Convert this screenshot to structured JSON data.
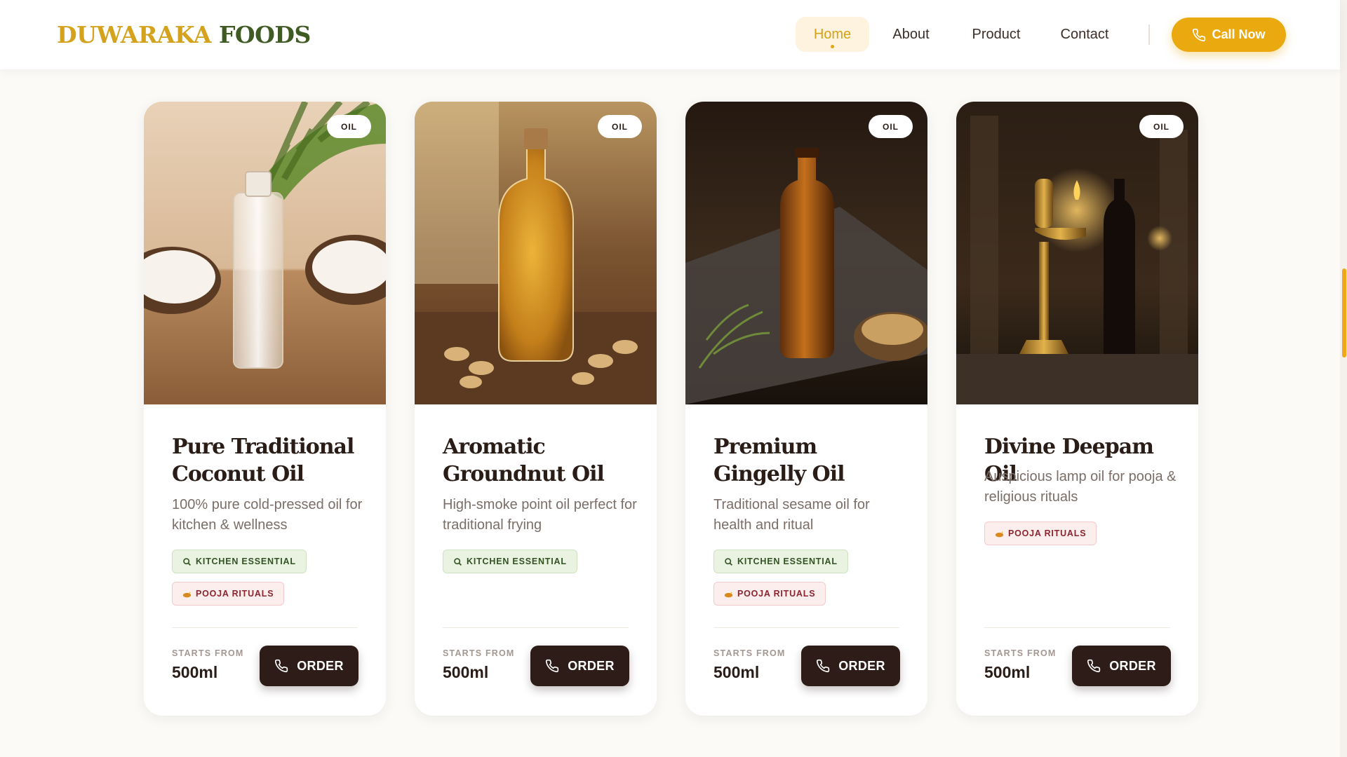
{
  "brand": {
    "word1": "DUWARAKA",
    "word2": "FOODS"
  },
  "nav": {
    "items": [
      {
        "label": "Home",
        "active": true
      },
      {
        "label": "About",
        "active": false
      },
      {
        "label": "Product",
        "active": false
      },
      {
        "label": "Contact",
        "active": false
      }
    ],
    "cta_label": "Call Now"
  },
  "colors": {
    "accent": "#eaa90f",
    "brand_gold": "#d4a21c",
    "brand_green": "#3f5a22",
    "order_button": "#2d1c17"
  },
  "products": [
    {
      "badge": "OIL",
      "title": "Pure Traditional Coconut Oil",
      "description": "100% pure cold-pressed oil for kitchen & wellness",
      "tags": [
        {
          "label": "KITCHEN ESSENTIAL",
          "kind": "kitchen",
          "icon": "search-icon"
        },
        {
          "label": "POOJA RITUALS",
          "kind": "pooja",
          "icon": "lamp-icon"
        }
      ],
      "starts_label": "STARTS FROM",
      "size": "500ml",
      "order_label": "ORDER"
    },
    {
      "badge": "OIL",
      "title": "Aromatic Groundnut Oil",
      "description": "High-smoke point oil perfect for traditional frying",
      "tags": [
        {
          "label": "KITCHEN ESSENTIAL",
          "kind": "kitchen",
          "icon": "search-icon"
        }
      ],
      "starts_label": "STARTS FROM",
      "size": "500ml",
      "order_label": "ORDER"
    },
    {
      "badge": "OIL",
      "title": "Premium Gingelly Oil",
      "description": "Traditional sesame oil for health and ritual",
      "tags": [
        {
          "label": "KITCHEN ESSENTIAL",
          "kind": "kitchen",
          "icon": "search-icon"
        },
        {
          "label": "POOJA RITUALS",
          "kind": "pooja",
          "icon": "lamp-icon"
        }
      ],
      "starts_label": "STARTS FROM",
      "size": "500ml",
      "order_label": "ORDER"
    },
    {
      "badge": "OIL",
      "title": "Divine Deepam Oil",
      "description": "Auspicious lamp oil for pooja & religious rituals",
      "tags": [
        {
          "label": "POOJA RITUALS",
          "kind": "pooja",
          "icon": "lamp-icon"
        }
      ],
      "starts_label": "STARTS FROM",
      "size": "500ml",
      "order_label": "ORDER"
    }
  ]
}
